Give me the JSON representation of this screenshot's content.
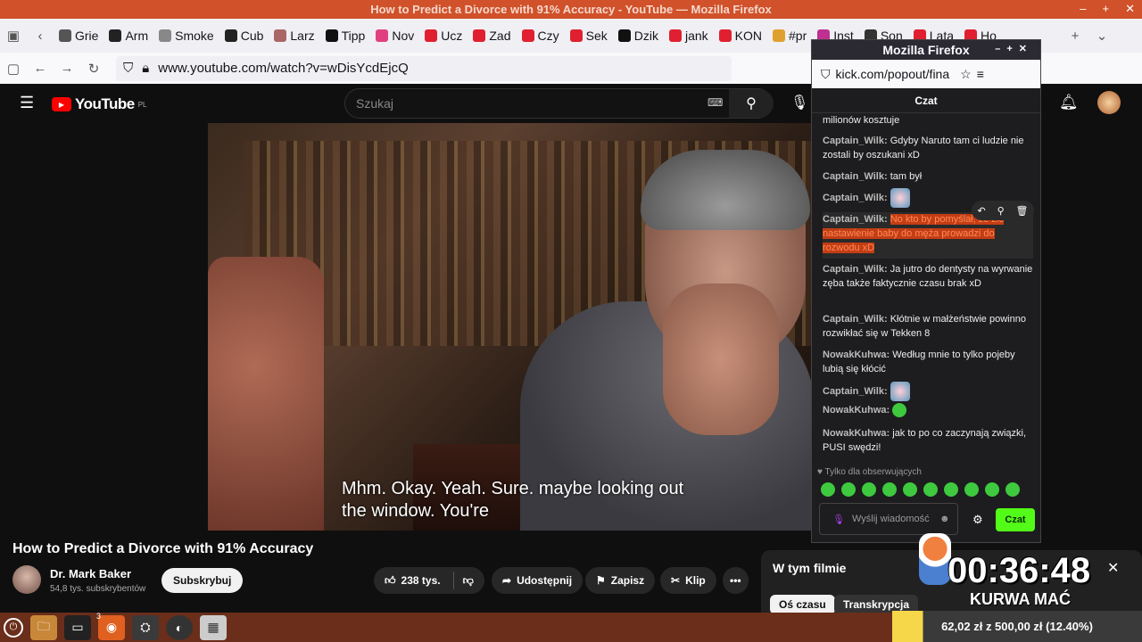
{
  "window": {
    "title": "How to Predict a Divorce with 91% Accuracy - YouTube — Mozilla Firefox",
    "minimize": "–",
    "maximize": "+",
    "close": "✕"
  },
  "tabs": [
    {
      "label": "Grie",
      "color": "#555"
    },
    {
      "label": "Arm",
      "color": "#222"
    },
    {
      "label": "Smoke",
      "color": "#888"
    },
    {
      "label": "Cub",
      "color": "#222"
    },
    {
      "label": "Larz",
      "color": "#a66"
    },
    {
      "label": "Tipp",
      "color": "#111"
    },
    {
      "label": "Nov",
      "color": "#e04080"
    },
    {
      "label": "Ucz",
      "color": "#e02030"
    },
    {
      "label": "Zad",
      "color": "#e02030"
    },
    {
      "label": "Czy",
      "color": "#e02030"
    },
    {
      "label": "Sek",
      "color": "#e02030"
    },
    {
      "label": "Dzik",
      "color": "#111"
    },
    {
      "label": "jank",
      "color": "#e02030"
    },
    {
      "label": "KON",
      "color": "#e02030"
    },
    {
      "label": "#pr",
      "color": "#e0a030"
    },
    {
      "label": "Inst",
      "color": "#c03090"
    },
    {
      "label": "Son",
      "color": "#333"
    },
    {
      "label": "Lata",
      "color": "#e02030"
    },
    {
      "label": "Ho",
      "color": "#e02030"
    }
  ],
  "nav": {
    "url": "www.youtube.com/watch?v=wDisYcdEjcQ"
  },
  "youtube": {
    "logo": "YouTube",
    "region": "PL",
    "search_placeholder": "Szukaj",
    "subtitle_line1": "Mhm. Okay. Yeah. Sure. maybe looking out",
    "subtitle_line2": "the window. You're",
    "video_title": "How to Predict a Divorce with 91% Accuracy",
    "channel": "Dr. Mark Baker",
    "subscribers": "54,8 tys. subskrybentów",
    "subscribe": "Subskrybuj",
    "likes": "238 tys.",
    "share": "Udostępnij",
    "save": "Zapisz",
    "clip": "Klip",
    "more": "•••",
    "in_film": "W tym filmie",
    "tab_timeline": "Oś czasu",
    "tab_transcript": "Transkrypcja"
  },
  "popout": {
    "title": "Mozilla Firefox",
    "url": "kick.com/popout/fina",
    "header": "Czat",
    "messages": [
      {
        "user": "",
        "text": "milionów kosztuje"
      },
      {
        "user": "Captain_Wilk:",
        "text": "Gdyby Naruto tam ci ludzie nie zostali by oszukani xD"
      },
      {
        "user": "Captain_Wilk:",
        "text": "tam był"
      },
      {
        "user": "Captain_Wilk:",
        "text": ""
      },
      {
        "user": "Captain_Wilk:",
        "text": "No kto by pomyślał, że złe nastawienie baby do męża prowadzi do rozwodu xD"
      },
      {
        "user": "Captain_Wilk:",
        "text": "Ja jutro do dentysty na wyrwanie zęba także faktycznie czasu brak xD"
      },
      {
        "user": "Captain_Wilk:",
        "text": "Kłótnie w małżeństwie powinno rozwikłać się w Tekken 8"
      },
      {
        "user": "NowakKuhwa:",
        "text": "Według mnie to tylko pojeby lubią się kłócić"
      },
      {
        "user": "Captain_Wilk:",
        "text": ""
      },
      {
        "user": "NowakKuhwa:",
        "text": ""
      },
      {
        "user": "NowakKuhwa:",
        "text": "jak to po co zaczynają związki, PUSI swędzi!"
      }
    ],
    "followers_only": "Tylko dla obserwujących",
    "input_placeholder": "Wyślij wiadomość",
    "send": "Czat"
  },
  "overlay": {
    "timer": "00:36:48",
    "caption": "KURWA MAĆ",
    "donation": "62,02 zł z 500,00 zł (12.40%)",
    "donation_progress": 0.124
  },
  "taskbar": {
    "badge": "3"
  }
}
